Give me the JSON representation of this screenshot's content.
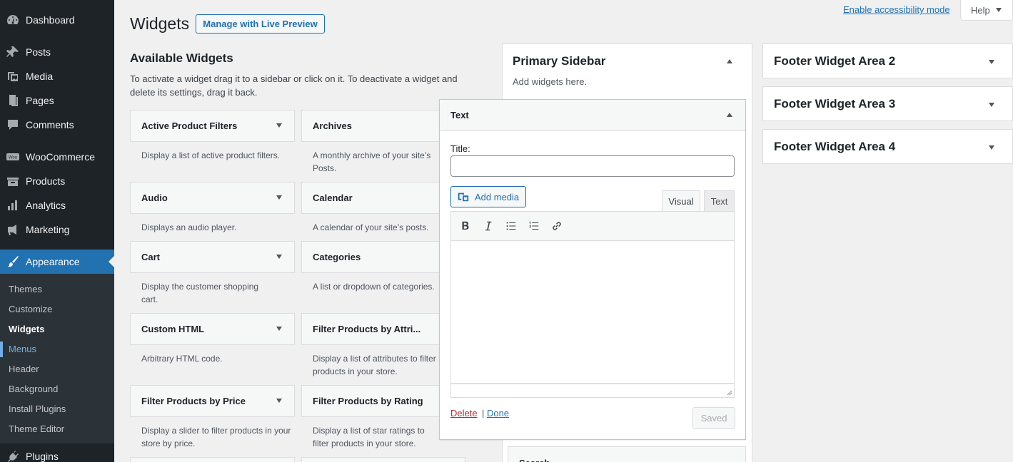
{
  "sidebar": {
    "items": [
      {
        "label": "Dashboard",
        "icon": "dashboard-icon"
      },
      {
        "label": "Posts",
        "icon": "pushpin-icon"
      },
      {
        "label": "Media",
        "icon": "media-icon"
      },
      {
        "label": "Pages",
        "icon": "pages-icon"
      },
      {
        "label": "Comments",
        "icon": "comment-icon"
      },
      {
        "label": "WooCommerce",
        "icon": "woocommerce-icon"
      },
      {
        "label": "Products",
        "icon": "products-icon"
      },
      {
        "label": "Analytics",
        "icon": "analytics-icon"
      },
      {
        "label": "Marketing",
        "icon": "megaphone-icon"
      },
      {
        "label": "Appearance",
        "icon": "paintbrush-icon"
      },
      {
        "label": "Plugins",
        "icon": "plugin-icon"
      }
    ],
    "submenu": [
      "Themes",
      "Customize",
      "Widgets",
      "Menus",
      "Header",
      "Background",
      "Install Plugins",
      "Theme Editor"
    ]
  },
  "header": {
    "title": "Widgets",
    "live_preview": "Manage with Live Preview",
    "accessibility": "Enable accessibility mode",
    "help": "Help"
  },
  "available": {
    "title": "Available Widgets",
    "description": "To activate a widget drag it to a sidebar or click on it. To deactivate a widget and delete its settings, drag it back.",
    "widgets": [
      {
        "name": "Active Product Filters",
        "desc": "Display a list of active product filters."
      },
      {
        "name": "Archives",
        "desc": "A monthly archive of your site’s Posts."
      },
      {
        "name": "Audio",
        "desc": "Displays an audio player."
      },
      {
        "name": "Calendar",
        "desc": "A calendar of your site’s posts."
      },
      {
        "name": "Cart",
        "desc": "Display the customer shopping cart."
      },
      {
        "name": "Categories",
        "desc": "A list or dropdown of categories."
      },
      {
        "name": "Custom HTML",
        "desc": "Arbitrary HTML code."
      },
      {
        "name": "Filter Products by Attri...",
        "desc": "Display a list of attributes to filter products in your store."
      },
      {
        "name": "Filter Products by Price",
        "desc": "Display a slider to filter products in your store by price."
      },
      {
        "name": "Filter Products by Rating",
        "desc": "Display a list of star ratings to filter products in your store."
      }
    ]
  },
  "primary_sidebar": {
    "title": "Primary Sidebar",
    "hint": "Add widgets here."
  },
  "text_widget": {
    "header": "Text",
    "title_label": "Title:",
    "title_value": "",
    "add_media": "Add media",
    "tab_visual": "Visual",
    "tab_text": "Text",
    "delete": "Delete",
    "separator": "|",
    "done": "Done",
    "saved": "Saved"
  },
  "search_widget": "Search",
  "footer_areas": [
    "Footer Widget Area 2",
    "Footer Widget Area 3",
    "Footer Widget Area 4"
  ],
  "colors": {
    "accent": "#2271b1",
    "menu_bg": "#1d2327",
    "delete": "#b32d2e"
  }
}
